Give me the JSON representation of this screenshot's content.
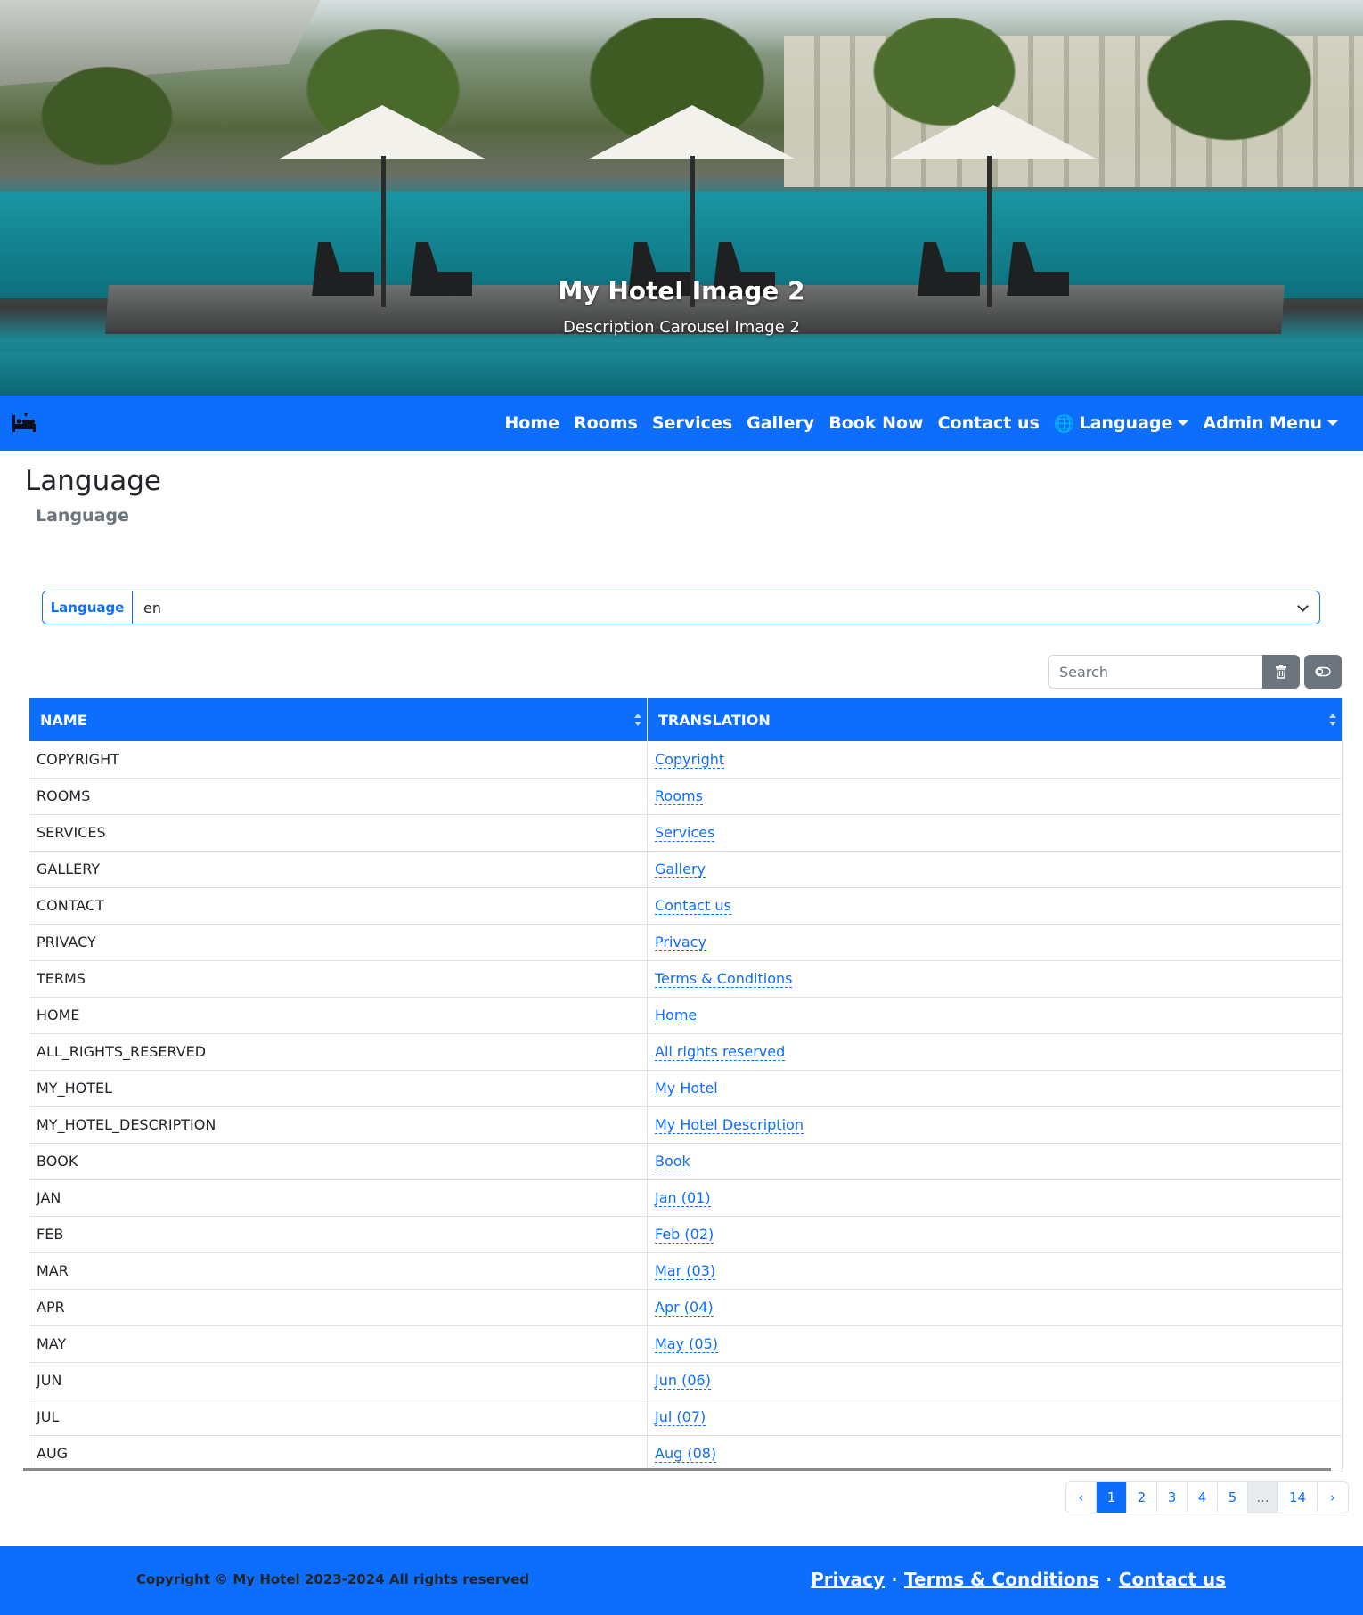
{
  "carousel": {
    "title": "My Hotel Image 2",
    "description": "Description Carousel Image 2"
  },
  "navbar": {
    "brand_icon": "hotel-bed-icon",
    "links": [
      "Home",
      "Rooms",
      "Services",
      "Gallery",
      "Book Now",
      "Contact us"
    ],
    "language_label": "Language",
    "admin_label": "Admin Menu",
    "language_icon": "globe-icon"
  },
  "page": {
    "title": "Language",
    "subtitle": "Language"
  },
  "language_select": {
    "label": "Language",
    "value": "en"
  },
  "search": {
    "placeholder": "Search"
  },
  "table": {
    "columns": [
      "NAME",
      "TRANSLATION"
    ],
    "rows": [
      {
        "name": "COPYRIGHT",
        "translation": "Copyright"
      },
      {
        "name": "ROOMS",
        "translation": "Rooms"
      },
      {
        "name": "SERVICES",
        "translation": "Services"
      },
      {
        "name": "GALLERY",
        "translation": "Gallery"
      },
      {
        "name": "CONTACT",
        "translation": "Contact us"
      },
      {
        "name": "PRIVACY",
        "translation": "Privacy"
      },
      {
        "name": "TERMS",
        "translation": "Terms & Conditions"
      },
      {
        "name": "HOME",
        "translation": "Home"
      },
      {
        "name": "ALL_RIGHTS_RESERVED",
        "translation": "All rights reserved"
      },
      {
        "name": "MY_HOTEL",
        "translation": "My Hotel"
      },
      {
        "name": "MY_HOTEL_DESCRIPTION",
        "translation": "My Hotel Description"
      },
      {
        "name": "BOOK",
        "translation": "Book"
      },
      {
        "name": "JAN",
        "translation": "Jan (01)"
      },
      {
        "name": "FEB",
        "translation": "Feb (02)"
      },
      {
        "name": "MAR",
        "translation": "Mar (03)"
      },
      {
        "name": "APR",
        "translation": "Apr (04)"
      },
      {
        "name": "MAY",
        "translation": "May (05)"
      },
      {
        "name": "JUN",
        "translation": "Jun (06)"
      },
      {
        "name": "JUL",
        "translation": "Jul (07)"
      },
      {
        "name": "AUG",
        "translation": "Aug (08)"
      }
    ]
  },
  "pagination": {
    "prev": "‹",
    "pages": [
      "1",
      "2",
      "3",
      "4",
      "5"
    ],
    "ellipsis": "...",
    "last": "14",
    "next": "›",
    "current": "1"
  },
  "footer": {
    "copyright": "Copyright © My Hotel 2023-2024 All rights reserved",
    "links": [
      "Privacy",
      "Terms & Conditions",
      "Contact us"
    ],
    "separator": "·"
  },
  "colors": {
    "primary": "#0d6efd",
    "secondary": "#6c757d"
  }
}
